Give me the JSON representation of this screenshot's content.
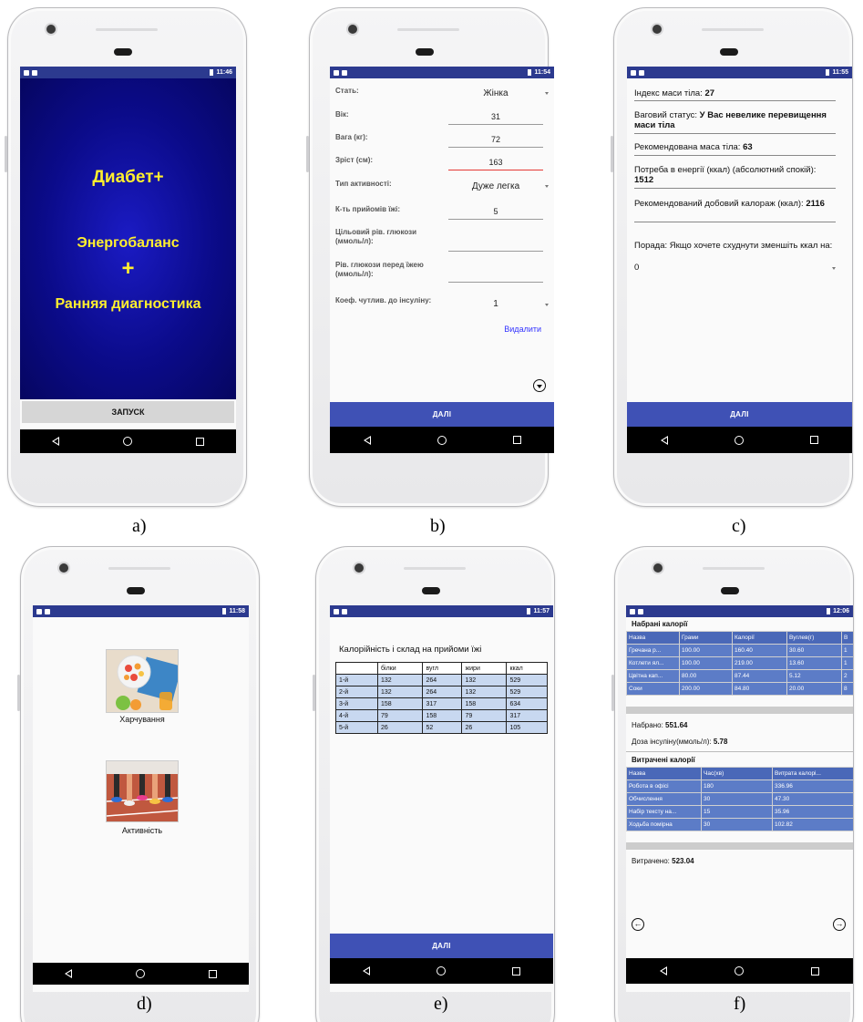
{
  "status_times": {
    "a": "11:46",
    "b": "11:54",
    "c": "11:55",
    "d": "11:58",
    "e": "11:57",
    "f": "12:06"
  },
  "captions": [
    "a)",
    "b)",
    "c)",
    "d)",
    "e)",
    "f)"
  ],
  "screen_a": {
    "title": "Диабет+",
    "line2": "Энергобаланс",
    "plus": "+",
    "line3": "Ранняя диагностика",
    "launch_label": "ЗАПУСК"
  },
  "screen_b": {
    "fields": [
      {
        "label": "Стать:",
        "value": "Жінка",
        "kind": "spinner"
      },
      {
        "label": "Вік:",
        "value": "31",
        "kind": "input"
      },
      {
        "label": "Вага (кг):",
        "value": "72",
        "kind": "input"
      },
      {
        "label": "Зріст (см):",
        "value": "163",
        "kind": "input-active"
      },
      {
        "label": "Тип активності:",
        "value": "Дуже легка",
        "kind": "spinner"
      },
      {
        "label": "К-ть прийомів їжі:",
        "value": "5",
        "kind": "input"
      },
      {
        "label": "Цільовий рів. глюкози (ммоль/л):",
        "value": "",
        "kind": "input"
      },
      {
        "label": "Рів. глюкози перед їжею (ммоль/л):",
        "value": "",
        "kind": "input"
      },
      {
        "label": "Коеф. чутлив. до інсуліну:",
        "value": "1",
        "kind": "spinner"
      }
    ],
    "delete_label": "Видалити",
    "next_label": "ДАЛІ"
  },
  "screen_c": {
    "bmi_label": "Індекс маси тіла: ",
    "bmi_value": "27",
    "weight_status_label": "Ваговий статус: ",
    "weight_status_value": "У Вас невелике перевищення маси тіла",
    "rec_weight_label": "Рекомендована маса тіла: ",
    "rec_weight_value": "63",
    "energy_label": "Потреба в енергії (ккал) (абсолютний спокій): ",
    "energy_value": "1512",
    "daily_label": "Рекомендований добовий калораж (ккал): ",
    "daily_value": "2116",
    "advice_label": "Порада: Якщо хочете схуднути зменшіть ккал на:",
    "advice_value": "0",
    "next_label": "ДАЛІ"
  },
  "screen_d": {
    "food_label": "Харчування",
    "activity_label": "Активність"
  },
  "screen_e": {
    "title": "Калорійність і склад на прийоми їжі",
    "headers": [
      "",
      "білки",
      "вугл",
      "жири",
      "ккал"
    ],
    "rows": [
      [
        "1-й",
        "132",
        "264",
        "132",
        "529"
      ],
      [
        "2-й",
        "132",
        "264",
        "132",
        "529"
      ],
      [
        "3-й",
        "158",
        "317",
        "158",
        "634"
      ],
      [
        "4-й",
        "79",
        "158",
        "79",
        "317"
      ],
      [
        "5-й",
        "26",
        "52",
        "26",
        "105"
      ]
    ],
    "next_label": "ДАЛІ"
  },
  "screen_f": {
    "gained_title": "Набрані калорії",
    "gained_headers": [
      "Назва",
      "Грами",
      "Калорії",
      "Вуглев(г)",
      "В"
    ],
    "gained_rows": [
      [
        "Гречана р...",
        "100.00",
        "160.40",
        "30.60",
        "1"
      ],
      [
        "Котлети ял...",
        "100.00",
        "219.00",
        "13.60",
        "1"
      ],
      [
        "Цвітна кап...",
        "80.00",
        "87.44",
        "5.12",
        "2"
      ],
      [
        "Соки",
        "200.00",
        "84.80",
        "20.00",
        "8"
      ]
    ],
    "gained_total_label": "Набрано: ",
    "gained_total_value": "551.64",
    "insulin_label": "Доза інсуліну(ммоль/л): ",
    "insulin_value": "5.78",
    "spent_title": "Витрачені калорії",
    "spent_headers": [
      "Назва",
      "Час(хв)",
      "Витрата калорі..."
    ],
    "spent_rows": [
      [
        "Робота в офісі",
        "180",
        "336.96"
      ],
      [
        "Обчислення",
        "30",
        "47.30"
      ],
      [
        "Набір тексту на...",
        "15",
        "35.96"
      ],
      [
        "Ходьба помірна",
        "30",
        "102.82"
      ]
    ],
    "spent_total_label": "Витрачено: ",
    "spent_total_value": "523.04",
    "prev_icon": "arrow-left-circle-icon",
    "next_icon": "arrow-right-circle-icon"
  }
}
